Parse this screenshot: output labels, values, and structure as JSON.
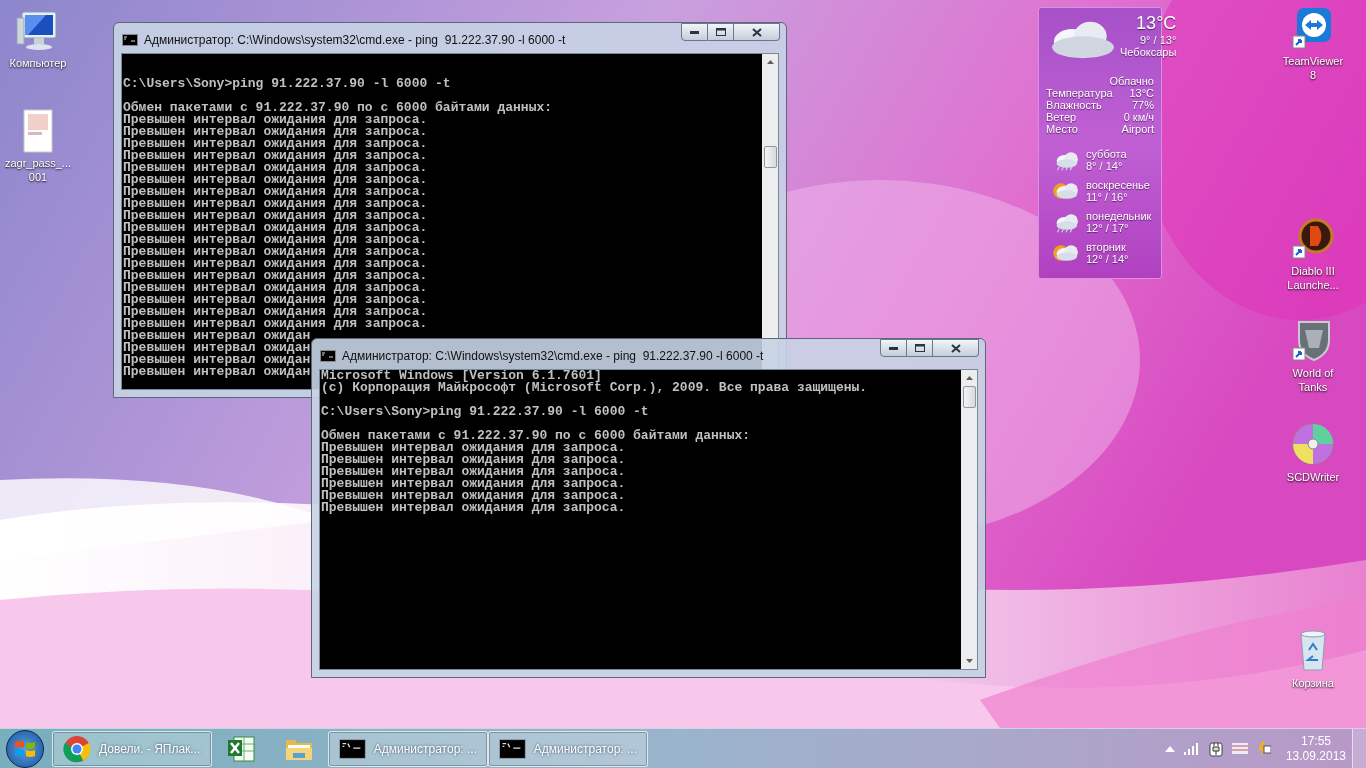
{
  "desktop_icons": [
    {
      "kind": "computer",
      "label": "Компьютер"
    },
    {
      "kind": "document",
      "label": "zagr_pass_...\n001"
    },
    {
      "kind": "teamviewer",
      "label": "TeamViewer\n8"
    },
    {
      "kind": "diablo",
      "label": "Diablo III\nLaunche..."
    },
    {
      "kind": "tanks",
      "label": "World of\nTanks"
    },
    {
      "kind": "disc",
      "label": "SCDWriter"
    },
    {
      "kind": "recycle-bin",
      "label": "Корзина"
    }
  ],
  "weather_gadget": {
    "temperature": "13°C",
    "range": "9° / 13°",
    "city": "Чебоксары",
    "condition": "Облачно",
    "details": [
      {
        "label": "Температура",
        "value": "13°C"
      },
      {
        "label": "Влажность",
        "value": "77%"
      },
      {
        "label": "Ветер",
        "value": "0 км/ч"
      },
      {
        "label": "Место",
        "value": "Airport"
      }
    ],
    "forecast": [
      {
        "kind": "rain",
        "day": "суббота",
        "range": "8° / 14°"
      },
      {
        "kind": "sun-cloud",
        "day": "воскресенье",
        "range": "11° / 16°"
      },
      {
        "kind": "rain",
        "day": "понедельник",
        "range": "12° / 17°"
      },
      {
        "kind": "sun-cloud",
        "day": "вторник",
        "range": "12° / 14°"
      }
    ]
  },
  "windows": [
    {
      "title": "Администратор: C:\\Windows\\system32\\cmd.exe - ping  91.222.37.90 -l 6000 -t",
      "blocks": [
        [
          "C:\\Users\\Sony>ping 91.222.37.90 -l 6000 -t"
        ],
        [
          "Обмен пакетами с 91.222.37.90 по с 6000 байтами данных:",
          "Превышен интервал ожидания для запроса.",
          "Превышен интервал ожидания для запроса.",
          "Превышен интервал ожидания для запроса.",
          "Превышен интервал ожидания для запроса.",
          "Превышен интервал ожидания для запроса.",
          "Превышен интервал ожидания для запроса.",
          "Превышен интервал ожидания для запроса.",
          "Превышен интервал ожидания для запроса.",
          "Превышен интервал ожидания для запроса.",
          "Превышен интервал ожидания для запроса.",
          "Превышен интервал ожидания для запроса.",
          "Превышен интервал ожидания для запроса.",
          "Превышен интервал ожидания для запроса.",
          "Превышен интервал ожидания для запроса.",
          "Превышен интервал ожидания для запроса.",
          "Превышен интервал ожидания для запроса.",
          "Превышен интервал ожидания для запроса.",
          "Превышен интервал ожидания для запроса.",
          "Превышен интервал ожидан",
          "Превышен интервал ожидан",
          "Превышен интервал ожидан",
          "Превышен интервал ожидан"
        ]
      ]
    },
    {
      "title": "Администратор: C:\\Windows\\system32\\cmd.exe - ping  91.222.37.90 -l 6000 -t",
      "blocks": [
        [
          "Microsoft Windows [Version 6.1.7601]",
          "(c) Корпорация Майкрософт (Microsoft Corp.), 2009. Все права защищены."
        ],
        [
          "C:\\Users\\Sony>ping 91.222.37.90 -l 6000 -t"
        ],
        [
          "Обмен пакетами с 91.222.37.90 по с 6000 байтами данных:",
          "Превышен интервал ожидания для запроса.",
          "Превышен интервал ожидания для запроса.",
          "Превышен интервал ожидания для запроса.",
          "Превышен интервал ожидания для запроса.",
          "Превышен интервал ожидания для запроса.",
          "Превышен интервал ожидания для запроса."
        ]
      ]
    }
  ],
  "taskbar": {
    "items": [
      {
        "kind": "chrome",
        "running": true,
        "label": "Довели. - ЯПлак..."
      },
      {
        "kind": "excel",
        "running": false
      },
      {
        "kind": "explorer",
        "running": false
      },
      {
        "kind": "cmd",
        "running": true,
        "label": "Администратор: ..."
      },
      {
        "kind": "cmd",
        "running": true,
        "label": "Администратор: ..."
      }
    ],
    "clock": {
      "time": "17:55",
      "date": "13.09.2013"
    }
  }
}
